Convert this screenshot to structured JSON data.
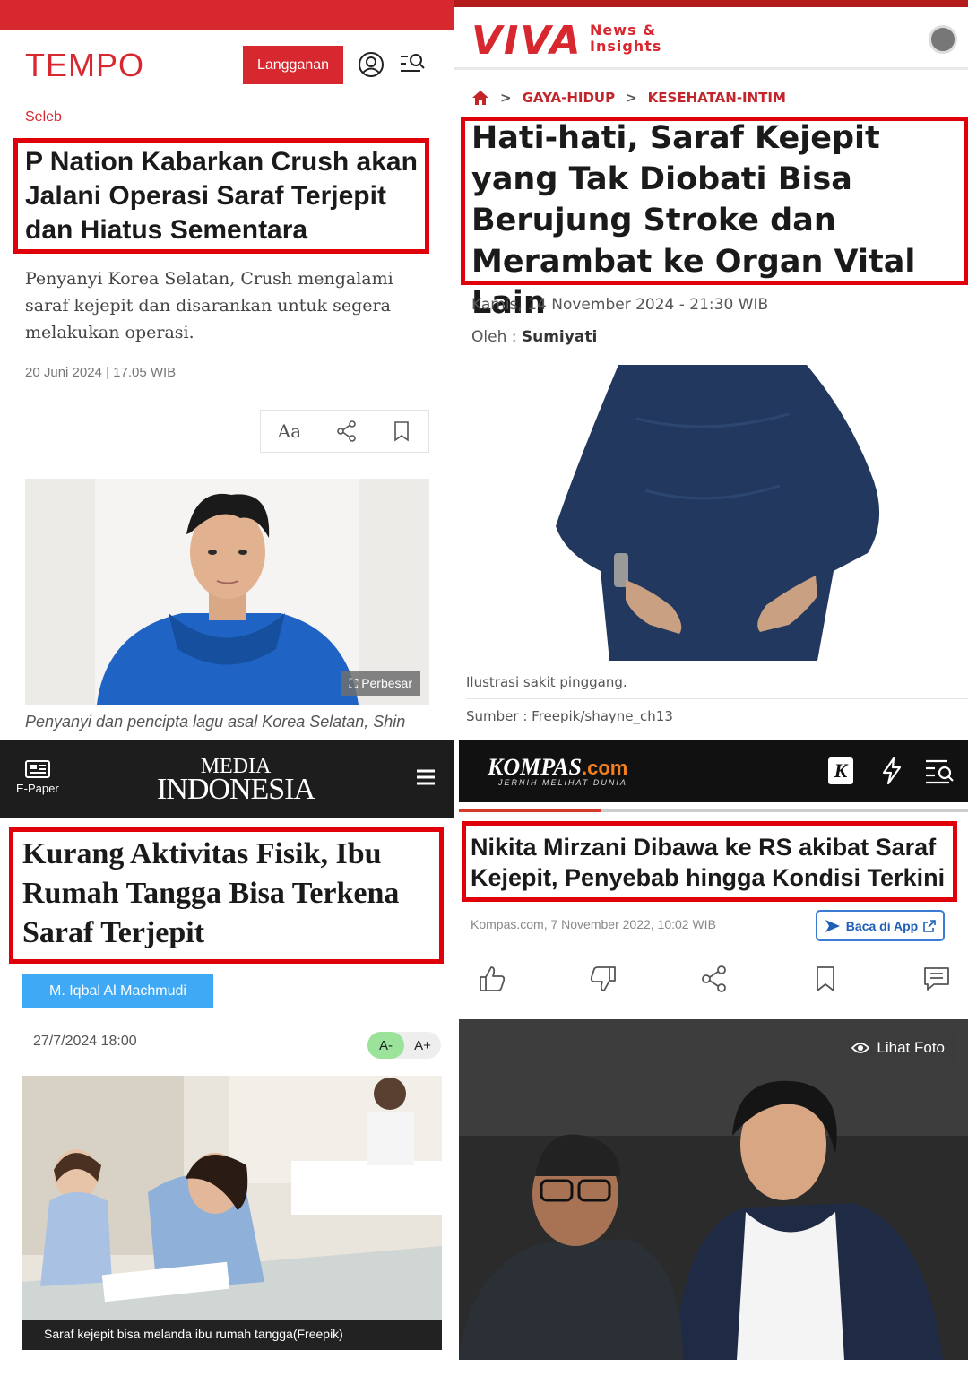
{
  "tempo": {
    "logo": "TEMPO",
    "subscribe_label": "Langganan",
    "category": "Seleb",
    "title": "P Nation Kabarkan Crush akan Jalani Operasi Saraf Terjepit dan Hiatus Sementara",
    "lead": "Penyanyi Korea Selatan, Crush mengalami saraf kejepit dan disarankan untuk segera melakukan operasi.",
    "date": "20 Juni 2024 | 17.05 WIB",
    "font_size_label": "Aa",
    "enlarge_label": "Perbesar",
    "caption": "Penyanyi dan pencipta lagu asal Korea Selatan, Shin",
    "brand_color": "#d7282f"
  },
  "viva": {
    "logo": "VIVA",
    "tagline_1": "News &",
    "tagline_2": "Insights",
    "breadcrumb": [
      "GAYA-HIDUP",
      "KESEHATAN-INTIM"
    ],
    "breadcrumb_sep": ">",
    "title": "Hati-hati, Saraf Kejepit yang Tak Diobati Bisa Berujung Stroke dan Merambat ke Organ Vital Lain",
    "date": "Kamis, 14 November 2024 - 21:30 WIB",
    "author_prefix": "Oleh :",
    "author": "Sumiyati",
    "caption": "Ilustrasi sakit pinggang.",
    "source": "Sumber :  Freepik/shayne_ch13",
    "brand_color": "#d7282f"
  },
  "media_indonesia": {
    "epaper_label": "E-Paper",
    "logo_line1": "MEDIA",
    "logo_line2": "INDONESIA",
    "title": "Kurang Aktivitas Fisik, Ibu Rumah Tangga Bisa Terkena Saraf Terjepit",
    "author": "M. Iqbal Al Machmudi",
    "date": "27/7/2024 18:00",
    "font_minus": "A-",
    "font_plus": "A+",
    "caption": "Saraf kejepit bisa melanda ibu rumah tangga(Freepik)",
    "accent_color": "#3fa9f5"
  },
  "kompas": {
    "logo": "KOMPAS",
    "logo_suffix": ".com",
    "tagline": "JERNIH MELIHAT DUNIA",
    "k_icon": "K",
    "title_line1": "Nikita Mirzani Dibawa ke RS akibat Saraf",
    "title_line2": "Kejepit, Penyebab hingga Kondisi Terkini",
    "date": "Kompas.com, 7 November 2022, 10:02 WIB",
    "app_button": "Baca di App",
    "photo_button": "Lihat Foto",
    "accent_color": "#f47f20"
  },
  "highlight_color": "#e0000a",
  "icons": [
    "user-icon",
    "search-menu-icon",
    "share-icon",
    "bookmark-icon",
    "expand-icon",
    "home-icon",
    "newspaper-icon",
    "hamburger-icon",
    "lightning-icon",
    "like-icon",
    "dislike-icon",
    "comment-icon",
    "eye-icon",
    "external-link-icon"
  ]
}
